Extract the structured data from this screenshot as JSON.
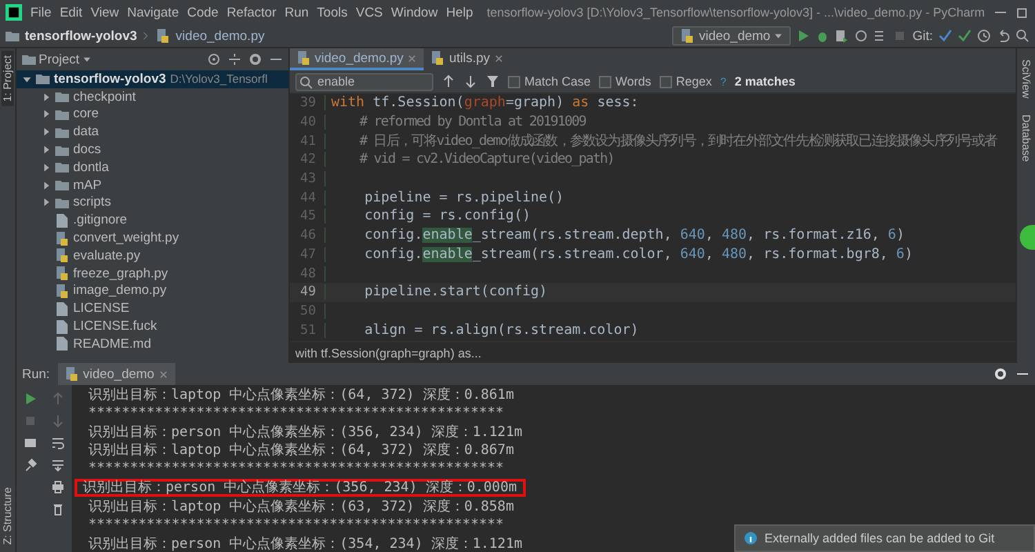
{
  "window": {
    "title": "tensorflow-yolov3 [D:\\Yolov3_Tensorflow\\tensorflow-yolov3] - ...\\video_demo.py - PyCharm"
  },
  "menu": [
    "File",
    "Edit",
    "View",
    "Navigate",
    "Code",
    "Refactor",
    "Run",
    "Tools",
    "VCS",
    "Window",
    "Help"
  ],
  "navigation": {
    "breadcrumb": [
      "tensorflow-yolov3",
      "video_demo.py"
    ],
    "run_config": "video_demo",
    "vcs_label": "Git:"
  },
  "left_strip": {
    "tabs": [
      "1: Project",
      "Z: Structure"
    ]
  },
  "right_strip": {
    "tabs": [
      "SciView",
      "Database"
    ]
  },
  "project": {
    "title": "Project",
    "tree": [
      {
        "name": "tensorflow-yolov3",
        "path": "D:\\Yolov3_Tensorfl",
        "kind": "folder",
        "expanded": true,
        "selected": true,
        "children": [
          {
            "name": "checkpoint",
            "kind": "folder",
            "expanded": false,
            "selected": false
          },
          {
            "name": "core",
            "kind": "folder",
            "expanded": false,
            "selected": false
          },
          {
            "name": "data",
            "kind": "folder",
            "expanded": false,
            "selected": false
          },
          {
            "name": "docs",
            "kind": "folder",
            "expanded": false,
            "selected": false
          },
          {
            "name": "dontla",
            "kind": "folder",
            "expanded": false,
            "selected": false
          },
          {
            "name": "mAP",
            "kind": "folder",
            "expanded": false,
            "selected": false
          },
          {
            "name": "scripts",
            "kind": "folder",
            "expanded": false,
            "selected": false
          },
          {
            "name": ".gitignore",
            "kind": "ignore",
            "selected": false
          },
          {
            "name": "convert_weight.py",
            "kind": "python",
            "selected": false
          },
          {
            "name": "evaluate.py",
            "kind": "python",
            "selected": false
          },
          {
            "name": "freeze_graph.py",
            "kind": "python",
            "selected": false
          },
          {
            "name": "image_demo.py",
            "kind": "python",
            "selected": false
          },
          {
            "name": "LICENSE",
            "kind": "text",
            "selected": false
          },
          {
            "name": "LICENSE.fuck",
            "kind": "text",
            "selected": false
          },
          {
            "name": "README.md",
            "kind": "markdown",
            "selected": false
          }
        ]
      }
    ]
  },
  "editor": {
    "tabs": [
      {
        "label": "video_demo.py",
        "selected": true
      },
      {
        "label": "utils.py",
        "selected": false
      }
    ],
    "search": {
      "value": "enable",
      "options": [
        {
          "label": "Match Case",
          "checked": false
        },
        {
          "label": "Words",
          "checked": false
        },
        {
          "label": "Regex",
          "checked": false
        }
      ],
      "help": "?",
      "matches": "2 matches"
    },
    "lines": [
      {
        "number": "39",
        "current": false,
        "segments": [
          {
            "text": "with",
            "kind": "keyword"
          },
          {
            "text": " tf.Session(",
            "kind": "plain"
          },
          {
            "text": "graph",
            "kind": "param"
          },
          {
            "text": "=graph) ",
            "kind": "plain"
          },
          {
            "text": "as",
            "kind": "keyword"
          },
          {
            "text": " sess:",
            "kind": "plain"
          }
        ]
      },
      {
        "number": "40",
        "current": false,
        "segments": [
          {
            "text": "    # reformed by Dontla at 20191009",
            "kind": "comment"
          }
        ]
      },
      {
        "number": "41",
        "current": false,
        "segments": [
          {
            "text": "    # 日后，可将video_demo做成函数，参数设为摄像头序列号，到时在外部文件先检测获取已连接摄像头序列号或者",
            "kind": "comment"
          }
        ]
      },
      {
        "number": "42",
        "current": false,
        "segments": [
          {
            "text": "    # vid = cv2.VideoCapture(video_path)",
            "kind": "comment"
          }
        ]
      },
      {
        "number": "43",
        "current": false
      },
      {
        "number": "44",
        "current": false,
        "segments": [
          {
            "text": "    pipeline = rs.pipeline()",
            "kind": "plain"
          }
        ]
      },
      {
        "number": "45",
        "current": false,
        "segments": [
          {
            "text": "    config = rs.config()",
            "kind": "plain"
          }
        ]
      },
      {
        "number": "46",
        "current": false,
        "segments": [
          {
            "text": "    config.",
            "kind": "plain"
          },
          {
            "text": "enable",
            "kind": "match"
          },
          {
            "text": "_stream(rs.stream.depth, ",
            "kind": "plain"
          },
          {
            "text": "640",
            "kind": "number"
          },
          {
            "text": ", ",
            "kind": "plain"
          },
          {
            "text": "480",
            "kind": "number"
          },
          {
            "text": ", rs.format.z16, ",
            "kind": "plain"
          },
          {
            "text": "6",
            "kind": "number"
          },
          {
            "text": ")",
            "kind": "plain"
          }
        ]
      },
      {
        "number": "47",
        "current": false,
        "segments": [
          {
            "text": "    config.",
            "kind": "plain"
          },
          {
            "text": "enable",
            "kind": "match"
          },
          {
            "text": "_stream(rs.stream.color, ",
            "kind": "plain"
          },
          {
            "text": "640",
            "kind": "number"
          },
          {
            "text": ", ",
            "kind": "plain"
          },
          {
            "text": "480",
            "kind": "number"
          },
          {
            "text": ", rs.format.bgr8, ",
            "kind": "plain"
          },
          {
            "text": "6",
            "kind": "number"
          },
          {
            "text": ")",
            "kind": "plain"
          }
        ]
      },
      {
        "number": "48",
        "current": false
      },
      {
        "number": "49",
        "current": true,
        "segments": [
          {
            "text": "    pipeline.start(config)",
            "kind": "plain"
          }
        ]
      },
      {
        "number": "50",
        "current": false
      },
      {
        "number": "51",
        "current": false,
        "segments": [
          {
            "text": "    align = rs.align(rs.stream.color)",
            "kind": "plain"
          }
        ]
      }
    ],
    "breadcrumb": "with tf.Session(graph=graph) as..."
  },
  "run": {
    "label": "Run:",
    "tab": "video_demo",
    "output": [
      {
        "text": "识别出目标：laptop 中心点像素坐标：(64, 372) 深度：0.861m",
        "highlighted": false
      },
      {
        "text": "**************************************************",
        "highlighted": false
      },
      {
        "text": "识别出目标：person 中心点像素坐标：(356, 234) 深度：1.121m",
        "highlighted": false
      },
      {
        "text": "识别出目标：laptop 中心点像素坐标：(64, 372) 深度：0.867m",
        "highlighted": false
      },
      {
        "text": "**************************************************",
        "highlighted": false
      },
      {
        "text": "识别出目标：person 中心点像素坐标：(356, 234) 深度：0.000m",
        "highlighted": true
      },
      {
        "text": "识别出目标：laptop 中心点像素坐标：(63, 372) 深度：0.858m",
        "highlighted": false
      },
      {
        "text": "**************************************************",
        "highlighted": false
      },
      {
        "text": "识别出目标：person 中心点像素坐标：(354, 234) 深度：1.121m",
        "highlighted": false
      }
    ]
  },
  "notification": {
    "text": "Externally added files can be added to Git"
  }
}
